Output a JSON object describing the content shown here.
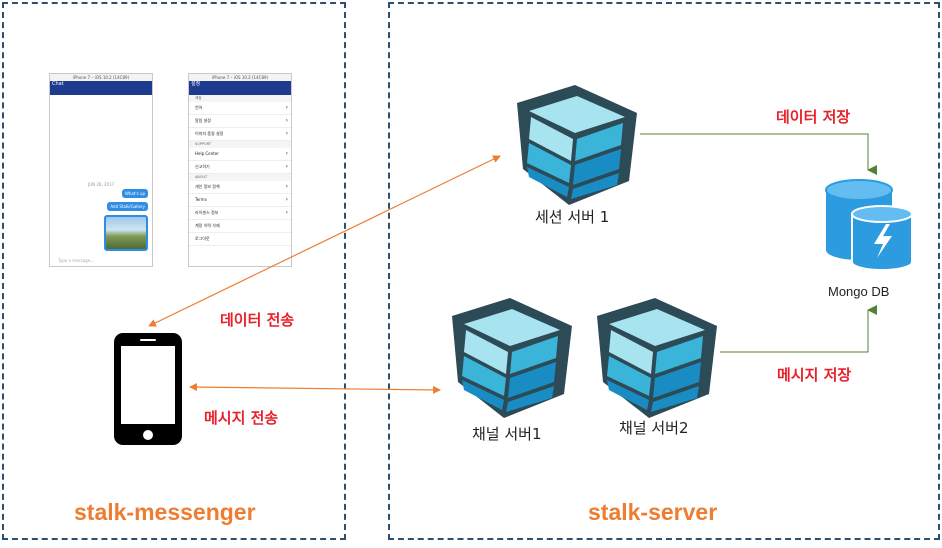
{
  "panels": {
    "left_title": "stalk-messenger",
    "right_title": "stalk-server"
  },
  "labels": {
    "data_transfer": "데이터 전송",
    "message_transfer": "메시지 전송",
    "data_store": "데이터 저장",
    "message_store": "메시지 저장"
  },
  "nodes": {
    "session_server": "세션 서버 1",
    "channel_server_1": "채널 서버1",
    "channel_server_2": "채널 서버2",
    "database": "Mongo DB"
  },
  "icons": {
    "server": "server-cube-icon",
    "database": "mongodb-database-icon",
    "phone": "smartphone-icon"
  },
  "colors": {
    "orange": "#ed7d31",
    "green": "#548235",
    "red": "#e8202a",
    "cube_frame": "#2d4a57",
    "cube_light": "#a8e4f0",
    "cube_mid": "#3ab4d9",
    "cube_dark": "#1a8cc4",
    "db_blue": "#2c9be0"
  },
  "screenshots": {
    "chat": {
      "status": "iPhone 7 – iOS 10.2 (14C89)",
      "nav_title": "Chat",
      "date": "JUN 28, 2017",
      "bubble_1": "What's up",
      "bubble_2": "Add Stalk/Gallery",
      "input_placeholder": "Type a message..."
    },
    "settings": {
      "status": "iPhone 7 – iOS 10.2 (14C89)",
      "nav_title": "설정",
      "section_1": "계정",
      "row_1": "언어",
      "row_2": "알림 설정",
      "row_3": "이미지 품질 설정",
      "section_2": "SUPPORT",
      "row_4": "Help Center",
      "row_5": "신고하기",
      "section_3": "ABOUT",
      "row_6": "개인 정보 정책",
      "row_7": "Terms",
      "row_8": "라이센스 정보",
      "row_9": "계정 이력 삭제",
      "row_10": "로그아웃"
    }
  }
}
